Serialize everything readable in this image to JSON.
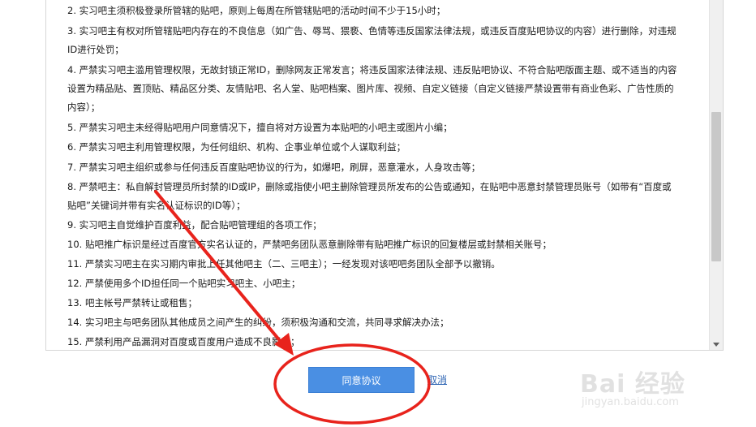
{
  "terms": [
    "2. 实习吧主须积极登录所管辖的贴吧，原则上每周在所管辖贴吧的活动时间不少于15小时；",
    "3. 实习吧主有权对所管辖贴吧内存在的不良信息（如广告、辱骂、猥亵、色情等违反国家法律法规，或违反百度贴吧协议的内容）进行删除，对违规",
    "ID进行处罚；",
    "4. 严禁实习吧主滥用管理权限，无故封锁正常ID，删除网友正常发言；将违反国家法律法规、违反贴吧协议、不符合贴吧版面主题、或不适当的内容",
    "设置为精品贴、置顶贴、精品区分类、友情贴吧、名人堂、贴吧档案、图片库、视频、自定义链接（自定义链接严禁设置带有商业色彩、广告性质的",
    "内容）；",
    "5. 严禁实习吧主未经得贴吧用户同意情况下，擅自将对方设置为本贴吧的小吧主或图片小编；",
    "6. 严禁实习吧主利用管理权限，为任何组织、机构、企事业单位或个人谋取利益；",
    "7. 严禁实习吧主组织或参与任何违反百度贴吧协议的行为，如爆吧，刷屏，恶意灌水，人身攻击等；",
    "8. 严禁吧主：私自解封管理员所封禁的ID或IP，删除或指使小吧主删除管理员所发布的公告或通知，在贴吧中恶意封禁管理员账号（如带有“百度或",
    "贴吧”关键词并带有实名认证标识的ID等）；",
    "9. 实习吧主自觉维护百度利益，配合贴吧管理组的各项工作；",
    "10. 贴吧推广标识是经过百度官方实名认证的，严禁吧务团队恶意删除带有贴吧推广标识的回复楼层或封禁相关账号；",
    "11. 严禁实习吧主在实习期内审批上任其他吧主（二、三吧主）；一经发现对该吧吧务团队全部予以撤销。",
    "12. 严禁使用多个ID担任同一个贴吧实习吧主、小吧主；",
    "13. 吧主帐号严禁转让或租售；",
    "14. 实习吧主与吧务团队其他成员之间产生的纠纷，须积极沟通和交流，共同寻求解决办法；",
    "15. 严禁利用产品漏洞对百度或百度用户造成不良影响；"
  ],
  "actions": {
    "agree_label": "同意协议",
    "cancel_label": "取消"
  },
  "watermark": {
    "logo_text": "Bai 经验",
    "url_text": "jingyan.baidu.com"
  },
  "colors": {
    "agree_button": "#4a8fe3",
    "annotation_red": "#e8231c",
    "cancel_link": "#2d64b3"
  }
}
